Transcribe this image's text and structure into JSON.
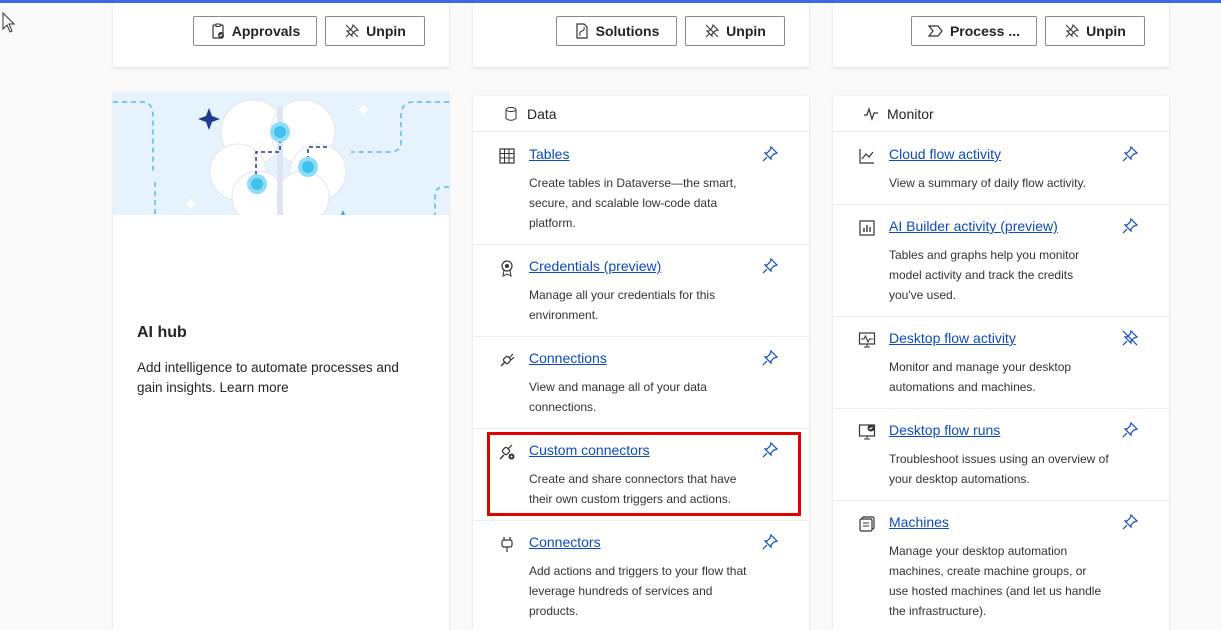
{
  "top_buttons": {
    "approvals_label": "Approvals",
    "unpin_label": "Unpin",
    "solutions_label": "Solutions",
    "process_label": "Process ..."
  },
  "ai_hub": {
    "title": "AI hub",
    "description": "Add intelligence to automate processes and gain insights. Learn more"
  },
  "data_card": {
    "heading": "Data",
    "items": [
      {
        "title": "Tables",
        "description": "Create tables in Dataverse—the smart, secure, and scalable low-code data platform.",
        "icon": "table-icon"
      },
      {
        "title": "Credentials (preview)",
        "description": "Manage all your credentials for this environment.",
        "icon": "credential-badge-icon"
      },
      {
        "title": "Connections",
        "description": "View and manage all of your data connections.",
        "icon": "plug-icon"
      },
      {
        "title": "Custom connectors",
        "description": "Create and share connectors that have their own custom triggers and actions.",
        "icon": "custom-plug-icon"
      },
      {
        "title": "Connectors",
        "description": "Add actions and triggers to your flow that leverage hundreds of services and products.",
        "icon": "connector-icon"
      }
    ]
  },
  "monitor_card": {
    "heading": "Monitor",
    "items": [
      {
        "title": "Cloud flow activity",
        "description": "View a summary of daily flow activity.",
        "icon": "line-chart-icon"
      },
      {
        "title": "AI Builder activity (preview)",
        "description": "Tables and graphs help you monitor model activity and track the credits you've used.",
        "icon": "bar-chart-icon"
      },
      {
        "title": "Desktop flow activity",
        "description": "Monitor and manage your desktop automations and machines.",
        "icon": "desktop-pulse-icon"
      },
      {
        "title": "Desktop flow runs",
        "description": "Troubleshoot issues using an overview of your desktop automations.",
        "icon": "desktop-check-icon"
      },
      {
        "title": "Machines",
        "description": "Manage your desktop automation machines, create machine groups, or use hosted machines (and let us handle the infrastructure).",
        "icon": "machines-icon"
      }
    ]
  },
  "colors": {
    "accent": "#0f4bb5",
    "highlight": "#e00000",
    "topline": "#3b6ae8"
  }
}
